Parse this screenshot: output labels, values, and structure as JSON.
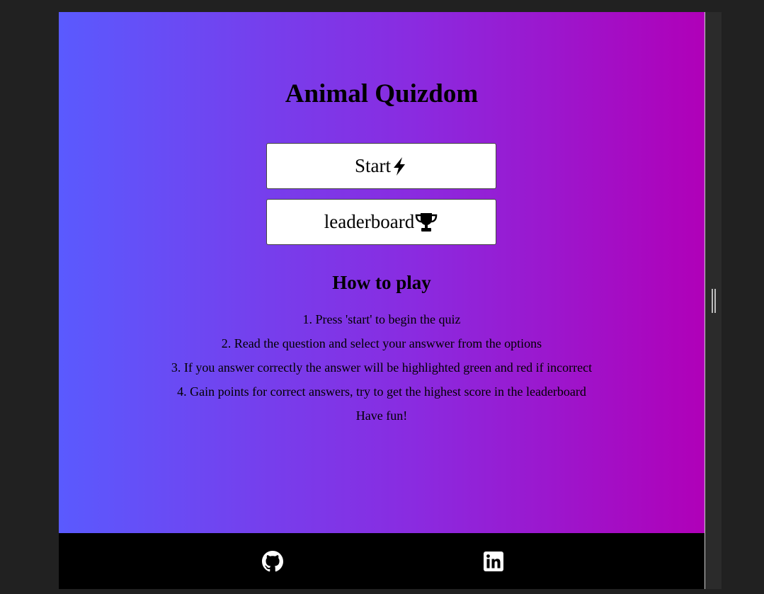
{
  "page": {
    "title": "Animal Quizdom"
  },
  "buttons": {
    "start_label": "Start",
    "start_icon": "lightning-bolt-icon",
    "leaderboard_label": "leaderboard",
    "leaderboard_icon": "trophy-icon"
  },
  "how_to_play": {
    "heading": "How to play",
    "steps": [
      "1. Press 'start' to begin the quiz",
      "2. Read the question and select your answwer from the options",
      "3. If you answer correctly the answer will be highlighted green and red if incorrect",
      "4. Gain points for correct answers, try to get the highest score in the leaderboard",
      "Have fun!"
    ]
  },
  "footer": {
    "links": [
      {
        "icon": "github-icon"
      },
      {
        "icon": "linkedin-icon"
      }
    ]
  },
  "colors": {
    "gradient_start": "#5a5afe",
    "gradient_end": "#b000b8",
    "footer_bg": "#000000",
    "button_bg": "#ffffff"
  }
}
